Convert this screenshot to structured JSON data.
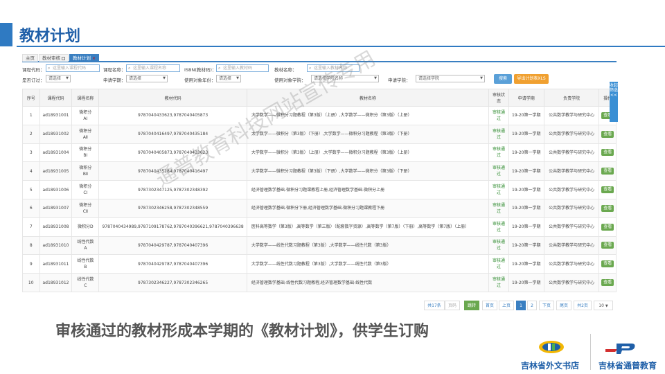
{
  "slide": {
    "title": "教材计划",
    "caption": "审核通过的教材形成本学期的《教材计划》，供学生订购",
    "watermark": "通普教育科技网站宣传专用",
    "footer_left": "吉林省外文书店",
    "footer_right": "吉林省通普教育"
  },
  "tabs": [
    {
      "label": "主页"
    },
    {
      "label": "教材审核"
    },
    {
      "label": "教材计划",
      "close": "×"
    }
  ],
  "filters": {
    "course_code": {
      "label": "课程代码：",
      "placeholder": "这里输入课程代码"
    },
    "course_name": {
      "label": "课程名称：",
      "placeholder": "这里输入课程名称"
    },
    "isbn": {
      "label": "ISBN(教材码)：",
      "placeholder": "这里输入教材码"
    },
    "textbook_name": {
      "label": "教材名称：",
      "placeholder": "这里输入教材名称"
    },
    "ordered": {
      "label": "是否订过：",
      "value": "请选择"
    },
    "term": {
      "label": "申请学期：",
      "value": "请选择"
    },
    "year": {
      "label": "使用对象年份：",
      "value": "请选择"
    },
    "college": {
      "label": "使用对象学院：",
      "value": "请选择学院名称"
    },
    "apply_college": {
      "label": "申请学院：",
      "value": "请选择学院"
    },
    "search_button": "搜索",
    "export_button": "导出计划表XLS"
  },
  "side_tab": "收起筛选<<",
  "table": {
    "headers": [
      "序号",
      "课程代码",
      "课程名称",
      "教材代码",
      "教材名称",
      "审核状态",
      "申请学期",
      "负责学院",
      "操作"
    ],
    "rows": [
      {
        "no": "1",
        "code": "ad18931001",
        "name": "微积分\nAⅠ",
        "isbn": "9787040433623,9787040405873",
        "book": "大学数学——微积分习题教程（第3版）（上册）,大学数学——微积分（第3版）（上册）",
        "status": "审核通过",
        "term": "19-20第一学期",
        "college": "公共数学教学与研究中心",
        "op": "查看"
      },
      {
        "no": "2",
        "code": "ad18931002",
        "name": "微积分\nAⅡ",
        "isbn": "9787040416497,9787040435184",
        "book": "大学数学——微积分（第3版）（下册）,大学数学——微积分习题教程（第3版）（下册）",
        "status": "审核通过",
        "term": "19-20第一学期",
        "college": "公共数学教学与研究中心",
        "op": "查看"
      },
      {
        "no": "3",
        "code": "ad18931004",
        "name": "微积分\nBⅠ",
        "isbn": "9787040405873,9787040433623",
        "book": "大学数学——微积分（第3版）（上册）,大学数学——微积分习题教程（第3版）（上册）",
        "status": "审核通过",
        "term": "19-20第一学期",
        "college": "公共数学教学与研究中心",
        "op": "查看"
      },
      {
        "no": "4",
        "code": "ad18931005",
        "name": "微积分\nBⅡ",
        "isbn": "9787040435184,9787040416497",
        "book": "大学数学——微积分习题教程（第3版）（下册）,大学数学——微积分（第3版）（下册）",
        "status": "审核通过",
        "term": "19-20第一学期",
        "college": "公共数学教学与研究中心",
        "op": "查看"
      },
      {
        "no": "5",
        "code": "ad18931006",
        "name": "微积分\nCⅠ",
        "isbn": "9787302347125,9787302348392",
        "book": "经济管理数学基础-微积分习题课教程上册,经济管理数学基础-微积分上册",
        "status": "审核通过",
        "term": "19-20第一学期",
        "college": "公共数学教学与研究中心",
        "op": "查看"
      },
      {
        "no": "6",
        "code": "ad18931007",
        "name": "微积分\nCⅡ",
        "isbn": "9787302346258,9787302348559",
        "book": "经济管理数学基础-微积分下册,经济管理数学基础-微积分习题课教程下册",
        "status": "审核通过",
        "term": "19-20第一学期",
        "college": "公共数学教学与研究中心",
        "op": "查看"
      },
      {
        "no": "7",
        "code": "ad18931008",
        "name": "微积分D",
        "isbn": "9787040434989,9787109178762,9787040396621,9787040396638",
        "book": "医科高等数学（第3版）,高等数学（第三版）（配套数字资源）,高等数学（第7版）（下册）,高等数学（第7版）（上册）",
        "status": "审核通过",
        "term": "19-20第一学期",
        "college": "公共数学教学与研究中心",
        "op": "查看"
      },
      {
        "no": "8",
        "code": "ad18931010",
        "name": "线性代数\nA",
        "isbn": "9787040429787,9787040407396",
        "book": "大学数学——线性代数习题教程（第3版）,大学数学——线性代数（第3版）",
        "status": "审核通过",
        "term": "19-20第一学期",
        "college": "公共数学教学与研究中心",
        "op": "查看"
      },
      {
        "no": "9",
        "code": "ad18931011",
        "name": "线性代数\nB",
        "isbn": "9787040429787,9787040407396",
        "book": "大学数学——线性代数习题教程（第3版）,大学数学——线性代数（第3版）",
        "status": "审核通过",
        "term": "19-20第一学期",
        "college": "公共数学教学与研究中心",
        "op": "查看"
      },
      {
        "no": "10",
        "code": "ad18931012",
        "name": "线性代数\nC",
        "isbn": "9787302346227,9787302346265",
        "book": "经济管理数学基础-线性代数习题教程,经济管理数学基础-线性代数",
        "status": "审核通过",
        "term": "19-20第一学期",
        "college": "公共数学教学与研究中心",
        "op": "查看"
      }
    ]
  },
  "pager": {
    "total": "共17条",
    "page_label": "页码",
    "jump": "跳转",
    "first": "首页",
    "prev": "上页",
    "p1": "1",
    "p2": "2",
    "next": "下页",
    "last": "尾页",
    "pages": "共2页",
    "size": "10"
  },
  "colors": {
    "accent": "#3a7fc1",
    "title": "#1f5fa8",
    "ok": "#2e8b2e",
    "export": "#f0a030",
    "search": "#5aa0d8"
  }
}
